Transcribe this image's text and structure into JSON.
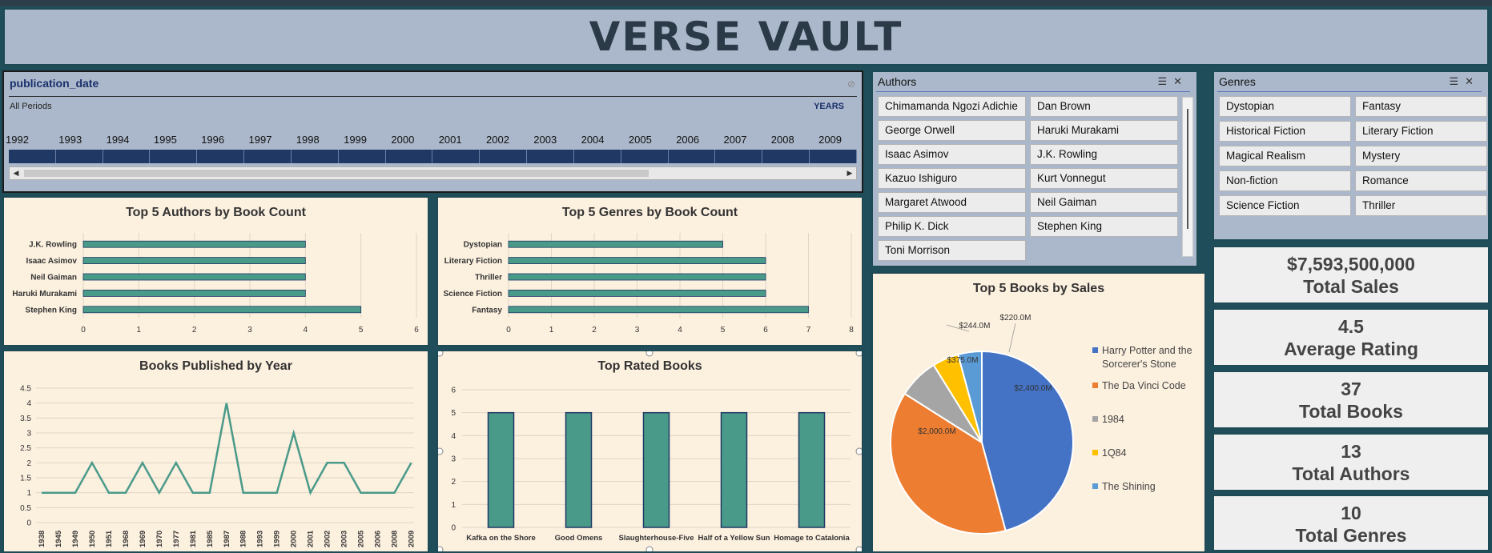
{
  "title": "VERSE VAULT",
  "timeline": {
    "field": "publication_date",
    "period": "All Periods",
    "unit": "YEARS",
    "years": [
      "1992",
      "1993",
      "1994",
      "1995",
      "1996",
      "1997",
      "1998",
      "1999",
      "2000",
      "2001",
      "2002",
      "2003",
      "2004",
      "2005",
      "2006",
      "2007",
      "2008",
      "2009"
    ]
  },
  "authors_slicer": {
    "header": "Authors",
    "items": [
      "Chimamanda Ngozi Adichie",
      "Dan Brown",
      "George Orwell",
      "Haruki Murakami",
      "Isaac Asimov",
      "J.K. Rowling",
      "Kazuo Ishiguro",
      "Kurt Vonnegut",
      "Margaret Atwood",
      "Neil Gaiman",
      "Philip K. Dick",
      "Stephen King",
      "Toni Morrison"
    ]
  },
  "genres_slicer": {
    "header": "Genres",
    "items": [
      "Dystopian",
      "Fantasy",
      "Historical Fiction",
      "Literary Fiction",
      "Magical Realism",
      "Mystery",
      "Non-fiction",
      "Romance",
      "Science Fiction",
      "Thriller"
    ]
  },
  "kpis": [
    {
      "value": "$7,593,500,000",
      "label": "Total Sales"
    },
    {
      "value": "4.5",
      "label": "Average Rating"
    },
    {
      "value": "37",
      "label": "Total Books"
    },
    {
      "value": "13",
      "label": "Total Authors"
    },
    {
      "value": "10",
      "label": "Total Genres"
    }
  ],
  "colors": {
    "bar": "#4a9a8a",
    "bar_border": "#1f3864",
    "panel": "#fcf0df"
  },
  "chart_data": [
    {
      "type": "bar",
      "orientation": "horizontal",
      "title": "Top 5 Authors by Book Count",
      "categories": [
        "J.K. Rowling",
        "Isaac Asimov",
        "Neil Gaiman",
        "Haruki Murakami",
        "Stephen King"
      ],
      "values": [
        4,
        4,
        4,
        4,
        5
      ],
      "xlim": [
        0,
        6
      ],
      "ticks": [
        "0",
        "1",
        "2",
        "3",
        "4",
        "5",
        "6"
      ]
    },
    {
      "type": "bar",
      "orientation": "horizontal",
      "title": "Top 5 Genres by Book Count",
      "categories": [
        "Dystopian",
        "Literary Fiction",
        "Thriller",
        "Science Fiction",
        "Fantasy"
      ],
      "values": [
        5,
        6,
        6,
        6,
        7
      ],
      "xlim": [
        0,
        8
      ],
      "ticks": [
        "0",
        "1",
        "2",
        "3",
        "4",
        "5",
        "6",
        "7",
        "8"
      ]
    },
    {
      "type": "line",
      "title": "Books Published by Year",
      "x": [
        "1938",
        "1945",
        "1949",
        "1950",
        "1951",
        "1968",
        "1969",
        "1970",
        "1977",
        "1981",
        "1985",
        "1987",
        "1988",
        "1993",
        "1999",
        "2000",
        "2001",
        "2002",
        "2003",
        "2005",
        "2006",
        "2008",
        "2009"
      ],
      "values": [
        1,
        1,
        1,
        2,
        1,
        1,
        2,
        1,
        2,
        1,
        1,
        4,
        1,
        1,
        1,
        3,
        1,
        2,
        2,
        1,
        1,
        1,
        2
      ],
      "ylim": [
        0,
        4.5
      ],
      "ticks": [
        "0",
        "0.5",
        "1",
        "1.5",
        "2",
        "2.5",
        "3",
        "3.5",
        "4",
        "4.5"
      ]
    },
    {
      "type": "bar",
      "title": "Top Rated Books",
      "categories": [
        "Kafka on the Shore",
        "Good Omens",
        "Slaughterhouse-Five",
        "Half of a Yellow Sun",
        "Homage to Catalonia"
      ],
      "values": [
        5,
        5,
        5,
        5,
        5
      ],
      "ylim": [
        0,
        6
      ],
      "ticks": [
        "0",
        "1",
        "2",
        "3",
        "4",
        "5",
        "6"
      ]
    },
    {
      "type": "pie",
      "title": "Top 5 Books by Sales",
      "categories": [
        "Harry Potter and the Sorcerer's Stone",
        "The Da Vinci Code",
        "1984",
        "1Q84",
        "The Shining"
      ],
      "legend_lines": [
        [
          "Harry Potter and the",
          "Sorcerer's Stone"
        ],
        [
          "The Da Vinci Code"
        ],
        [
          "1984"
        ],
        [
          "1Q84"
        ],
        [
          "The Shining"
        ]
      ],
      "values": [
        2400,
        2000,
        375,
        244,
        220
      ],
      "labels": [
        "$2,400.0M",
        "$2,000.0M",
        "$375.0M",
        "$244.0M",
        "$220.0M"
      ],
      "colors": [
        "#4472c4",
        "#ed7d31",
        "#a5a5a5",
        "#ffc000",
        "#5b9bd5"
      ],
      "legend": "right"
    }
  ]
}
